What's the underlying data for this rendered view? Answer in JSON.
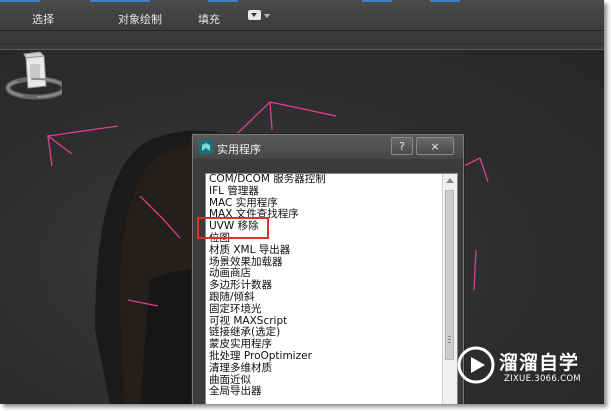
{
  "toolbar": {
    "tabs": [
      "选择",
      "对象绘制",
      "填充"
    ]
  },
  "dialog": {
    "title": "实用程序",
    "help_label": "?",
    "close_label": "×",
    "items": [
      "COM/DCOM 服务器控制",
      "IFL 管理器",
      "MAC 实用程序",
      "MAX 文件查找程序",
      "UVW 移除",
      "位图",
      "材质 XML 导出器",
      "场景效果加载器",
      "动画商店",
      "多边形计数器",
      "跟随/倾斜",
      "固定环境光",
      "可视 MAXScript",
      "链接继承(选定)",
      "蒙皮实用程序",
      "批处理 ProOptimizer",
      "清理多维材质",
      "曲面近似",
      "全局导出器"
    ]
  },
  "watermark": {
    "title": "溜溜自学",
    "sub": "ZIXUE.3066.COM"
  },
  "colors": {
    "highlight_border": "#e0302e",
    "gizmo": "#e03d8c",
    "accent": "#3d82c4"
  }
}
